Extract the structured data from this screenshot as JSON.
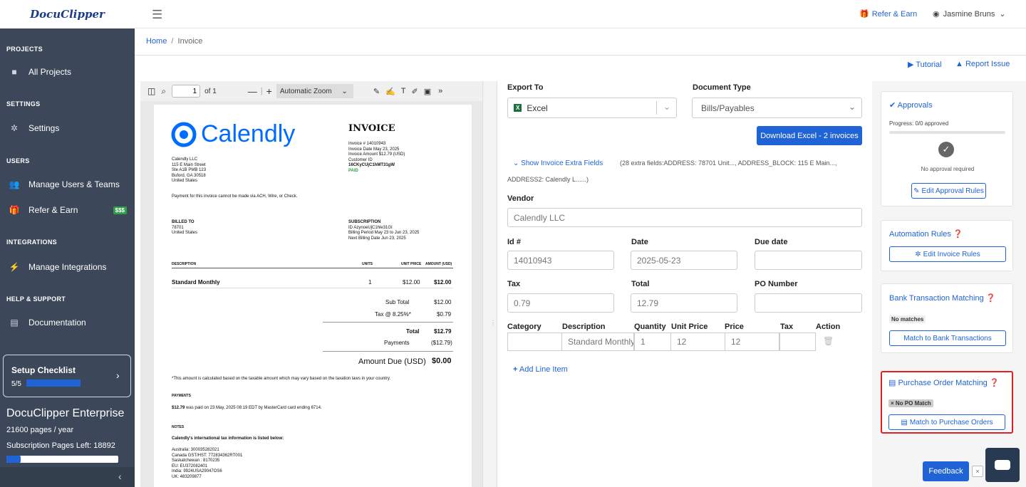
{
  "app": {
    "logo": "DocuClipper"
  },
  "header": {
    "refer_label": "Refer & Earn",
    "user_name": "Jasmine Bruns"
  },
  "breadcrumb": {
    "home": "Home",
    "sep": "/",
    "current": "Invoice"
  },
  "sidebar": {
    "sections": {
      "projects": "PROJECTS",
      "settings": "SETTINGS",
      "users": "USERS",
      "integrations": "INTEGRATIONS",
      "help": "HELP & SUPPORT"
    },
    "items": {
      "all_projects": "All Projects",
      "settings": "Settings",
      "manage_users": "Manage Users & Teams",
      "refer_earn": "Refer & Earn",
      "refer_badge": "$$$",
      "manage_integrations": "Manage Integrations",
      "documentation": "Documentation"
    },
    "checklist": {
      "title": "Setup Checklist",
      "progress_text": "5/5",
      "progress": 1.0
    },
    "plan": {
      "name": "DocuClipper Enterprise",
      "pages_year": "21600 pages / year",
      "pages_left": "Subscription Pages Left: 18892",
      "usage": 0.13
    }
  },
  "top_actions": {
    "tutorial": "Tutorial",
    "report": "Report Issue"
  },
  "viewer": {
    "page_value": "1",
    "page_of": "of 1",
    "zoom": "Automatic Zoom"
  },
  "invoice": {
    "brand": "Calendly",
    "title": "INVOICE",
    "meta": [
      "Invoice #  14010943",
      "Invoice Date  May 23, 2025",
      "Invoice Amount  $12.79 (USD)",
      "Customer ID",
      "16CKyCUjC1hMT31gW"
    ],
    "paid": "PAID",
    "from": [
      "Calendly LLC",
      "115 E Main Street",
      "Ste A1B PMB 123",
      "Buford, GA 30518",
      "United States"
    ],
    "ach_note": "Payment for this invoice cannot be made via ACH, Wire, or Check.",
    "billed_to_label": "BILLED TO",
    "billed_to": [
      "78701",
      "United States"
    ],
    "subscription_label": "SUBSCRIPTION",
    "subscription": [
      "ID  AzynoeUjC1hle31GI",
      "Billing Period  May 23 to Jun 23, 2025",
      "Next Billing Date  Jun 23, 2025"
    ],
    "cols": {
      "desc": "DESCRIPTION",
      "units": "UNITS",
      "price": "UNIT PRICE",
      "amount": "AMOUNT (USD)"
    },
    "line": {
      "desc": "Standard Monthly",
      "units": "1",
      "price": "$12.00",
      "amount": "$12.00"
    },
    "subtotal_label": "Sub Total",
    "subtotal": "$12.00",
    "tax_label": "Tax @ 8.25%*",
    "tax": "$0.79",
    "total_label": "Total",
    "total": "$12.79",
    "payments_label": "Payments",
    "payments": "($12.79)",
    "due_label": "Amount Due (USD)",
    "due": "$0.00",
    "footnote": "*This amount is calculated based on the taxable amount which may vary based on the taxation laws in your country.",
    "payments_head": "PAYMENTS",
    "payment_line_amount": "$12.79",
    "payment_line_text": "was paid on 23 May, 2025 08:19 EDT by MasterCard card ending 6714.",
    "notes_head": "NOTES",
    "notes_title": "Calendly's international tax information is listed below:",
    "tax_ids": [
      "Australia: 300035282021",
      "Canada GST/HST: 772834362RT001",
      "Saskatchewan : 8170235",
      "EU: EU372082401",
      "India: 9924USA29047OS6",
      "UK: 483209877"
    ]
  },
  "form": {
    "export_label": "Export To",
    "export_value": "Excel",
    "doctype_label": "Document Type",
    "doctype_value": "Bills/Payables",
    "download_btn": "Download Excel - 2 invoices",
    "extra_link": "Show Invoice Extra Fields",
    "extra_info": "(28 extra fields:ADDRESS: 78701 Unit..., ADDRESS_BLOCK: 115 E Main...,",
    "extra_info2": "ADDRESS2: Calendly L......)",
    "vendor_label": "Vendor",
    "vendor_value": "Calendly LLC",
    "id_label": "Id #",
    "id_value": "14010943",
    "date_label": "Date",
    "date_value": "2025-05-23",
    "due_label": "Due date",
    "due_value": "",
    "tax_label": "Tax",
    "tax_value": "0.79",
    "total_label": "Total",
    "total_value": "12.79",
    "po_label": "PO Number",
    "po_value": "",
    "line_cols": {
      "category": "Category",
      "description": "Description",
      "quantity": "Quantity",
      "unit_price": "Unit Price",
      "price": "Price",
      "tax": "Tax",
      "action": "Action"
    },
    "line_item": {
      "category": "",
      "description": "Standard Monthly",
      "quantity": "1",
      "unit_price": "12",
      "price": "12",
      "tax": ""
    },
    "add_line": "Add Line Item"
  },
  "right": {
    "approvals": {
      "title": "Approvals",
      "progress": "Progress: 0/0 approved",
      "none": "No approval required",
      "btn": "Edit Approval Rules"
    },
    "automation": {
      "title": "Automation Rules",
      "btn": "Edit Invoice Rules"
    },
    "bank": {
      "title": "Bank Transaction Matching",
      "badge": "No matches",
      "btn": "Match to Bank Transactions"
    },
    "po": {
      "title": "Purchase Order Matching",
      "badge": "× No PO Match",
      "btn": "Match to Purchase Orders"
    },
    "feedback": "Feedback",
    "feedback_close": "×"
  },
  "colors": {
    "sidebar": "#3c4859",
    "accent": "#1f63d6",
    "highlight": "#e02020"
  }
}
